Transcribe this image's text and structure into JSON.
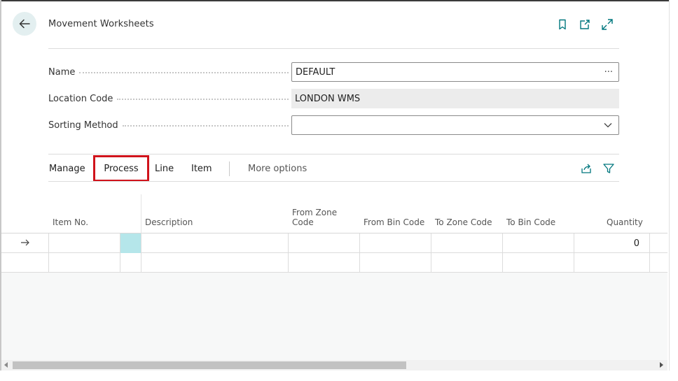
{
  "header": {
    "title": "Movement Worksheets",
    "back_icon": "arrow-left-icon",
    "actions": [
      {
        "name": "bookmark",
        "icon": "bookmark-icon"
      },
      {
        "name": "open-in-new-window",
        "icon": "open-new-icon"
      },
      {
        "name": "expand",
        "icon": "expand-icon"
      }
    ],
    "accent_color": "#00777e"
  },
  "fields": {
    "name": {
      "label": "Name",
      "value": "DEFAULT",
      "lookup": "···"
    },
    "location_code": {
      "label": "Location Code",
      "value": "LONDON WMS"
    },
    "sorting_method": {
      "label": "Sorting Method",
      "value": ""
    }
  },
  "action_bar": {
    "manage": "Manage",
    "process": "Process",
    "line": "Line",
    "item": "Item",
    "more": "More options",
    "highlight_color": "#d0131b"
  },
  "grid": {
    "columns": {
      "item_no": "Item No.",
      "description": "Description",
      "from_zone_code_1": "From Zone",
      "from_zone_code_2": "Code",
      "from_bin_code": "From Bin Code",
      "to_zone_code": "To Zone Code",
      "to_bin_code": "To Bin Code",
      "quantity": "Quantity"
    },
    "rows": [
      {
        "item_no": "",
        "description": "",
        "from_zone_code": "",
        "from_bin_code": "",
        "to_zone_code": "",
        "to_bin_code": "",
        "quantity": "0"
      },
      {
        "item_no": "",
        "description": "",
        "from_zone_code": "",
        "from_bin_code": "",
        "to_zone_code": "",
        "to_bin_code": "",
        "quantity": ""
      }
    ]
  }
}
